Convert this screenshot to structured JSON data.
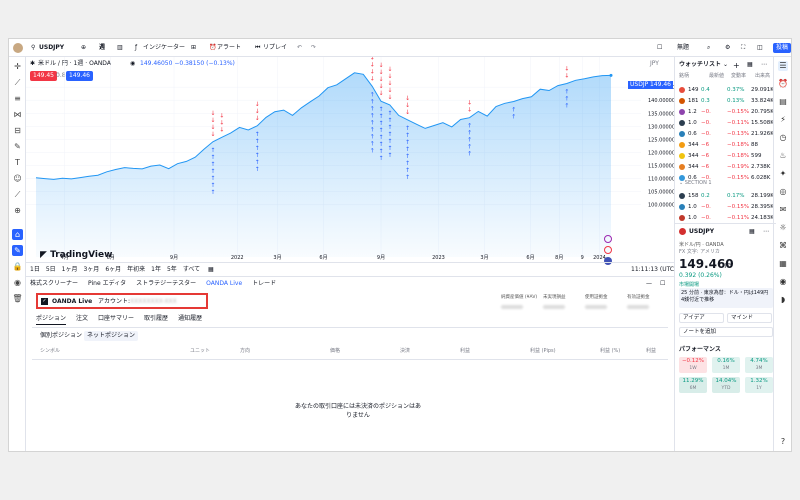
{
  "topbar": {
    "symbol": "USDJPY",
    "indicators": "インジケーター",
    "alert": "アラート",
    "replay": "リプレイ",
    "save_label": "無題",
    "publish": "投稿"
  },
  "legend": {
    "title": "米ドル / 円 · 1週 · OANDA",
    "ohlc": "149.46050  −0.38150 (−0.13%)",
    "sell": "149.45",
    "buy": "149.46",
    "spread": "0.8"
  },
  "yaxis": {
    "currency": "JPY",
    "price_tag": "USDJPY",
    "current": "149.46",
    "ticks": [
      "145.00000",
      "140.00000",
      "135.00000",
      "130.00000",
      "125.00000",
      "120.00000",
      "115.00000",
      "110.00000",
      "105.00000",
      "100.00000"
    ]
  },
  "xaxis": {
    "ticks": [
      "4月",
      "6月",
      "9月",
      "2022",
      "3月",
      "6月",
      "9月",
      "2023",
      "3月",
      "6月",
      "8月",
      "9",
      "2024"
    ]
  },
  "watermark": "TradingView",
  "timeframes": [
    "1日",
    "5日",
    "1ヶ月",
    "3ヶ月",
    "6ヶ月",
    "年初来",
    "1年",
    "5年",
    "すべて"
  ],
  "clock": "11:11:13 (UTC+9)",
  "bottom": {
    "tabs": [
      "株式スクリーナー",
      "Pine エディタ",
      "ストラテジーテスター",
      "OANDA Live",
      "トレード"
    ],
    "broker": "OANDA Live",
    "account_label": "アカウント:",
    "account_value": "XXXXXXXX-XXX",
    "stats": [
      "純資産価値 (¥AV)",
      "未実現損益",
      "使用証拠金",
      "有効証拠金"
    ],
    "subtabs": [
      "ポジション",
      "注文",
      "口座サマリー",
      "取引履歴",
      "通知履歴"
    ],
    "filters": [
      "個別ポジション",
      "ネットポジション"
    ],
    "columns": [
      "シンボル",
      "ユニット",
      "方向",
      "価格",
      "決済",
      "利益",
      "利益 (Pips)",
      "利益 (%)",
      "利益"
    ],
    "empty": "あなたの取引口座には未決済のポジションはありません"
  },
  "watchlist": {
    "title": "ウォッチリスト",
    "cols": [
      "銘柄",
      "最新値",
      "変動率",
      "出来高"
    ],
    "rows": [
      {
        "sym": "149",
        "chg": "0.4",
        "pct": "0.37%",
        "vol": "29.091K",
        "up": true,
        "c": "#e74c3c"
      },
      {
        "sym": "181",
        "chg": "0.3",
        "pct": "0.13%",
        "vol": "33.824K",
        "up": true,
        "c": "#d35400"
      },
      {
        "sym": "1.2",
        "chg": "−0.",
        "pct": "−0.15%",
        "vol": "20.795K",
        "up": false,
        "c": "#8e44ad"
      },
      {
        "sym": "1.0",
        "chg": "−0.",
        "pct": "−0.11%",
        "vol": "15.508K",
        "up": false,
        "c": "#2c3e50"
      },
      {
        "sym": "0.6",
        "chg": "−0.",
        "pct": "−0.13%",
        "vol": "21.926K",
        "up": false,
        "c": "#2980b9"
      },
      {
        "sym": "344",
        "chg": "−6",
        "pct": "−0.18%",
        "vol": "88",
        "up": false,
        "c": "#f39c12"
      },
      {
        "sym": "344",
        "chg": "−6",
        "pct": "−0.18%",
        "vol": "599",
        "up": false,
        "c": "#f1c40f"
      },
      {
        "sym": "344",
        "chg": "−6",
        "pct": "−0.19%",
        "vol": "2.738K",
        "up": false,
        "c": "#e67e22"
      },
      {
        "sym": "0.6",
        "chg": "−0.",
        "pct": "−0.15%",
        "vol": "6.028K",
        "up": false,
        "c": "#3498db"
      }
    ],
    "section": "SECTION 1",
    "rows2": [
      {
        "sym": "158",
        "chg": "0.2",
        "pct": "0.17%",
        "vol": "28.199K",
        "up": true,
        "c": "#2c3e50"
      },
      {
        "sym": "1.0",
        "chg": "−0.",
        "pct": "−0.15%",
        "vol": "28.395K",
        "up": false,
        "c": "#2980b9"
      },
      {
        "sym": "1.0",
        "chg": "−0.",
        "pct": "−0.11%",
        "vol": "24.183K",
        "up": false,
        "c": "#c0392b"
      }
    ]
  },
  "detail": {
    "symbol": "USDJPY",
    "name": "米ドル/円",
    "exchange": "OANDA",
    "region": "FX 文字: アメリカ",
    "price": "149.460",
    "unit": "JPY",
    "change": "0.392 (0.26%)",
    "status": "市場開場",
    "news": "25 分前 · 東京為替：ドル・円は149円4銭付近で推移",
    "idea": "アイデア",
    "mind": "マインド",
    "note": "ノートを追加",
    "perf_title": "パフォーマンス",
    "perf": [
      {
        "v": "−0.12%",
        "l": "1W"
      },
      {
        "v": "0.16%",
        "l": "1M"
      },
      {
        "v": "4.74%",
        "l": "3M"
      },
      {
        "v": "11.29%",
        "l": "6M"
      },
      {
        "v": "14.04%",
        "l": "YTD"
      },
      {
        "v": "1.32%",
        "l": "1Y"
      }
    ]
  },
  "chart_data": {
    "type": "line",
    "series_name": "USDJPY",
    "ylim": [
      100,
      150
    ],
    "values": [
      110.3,
      110.0,
      109.7,
      110.1,
      109.9,
      110.4,
      110.9,
      111.3,
      112.6,
      113.5,
      114.2,
      113.9,
      113.7,
      114.8,
      115.2,
      113.8,
      115.7,
      116.6,
      118.2,
      121.3,
      124.1,
      125.8,
      127.4,
      129.6,
      128.6,
      130.2,
      133.4,
      135.6,
      136.2,
      134.2,
      137.1,
      139.4,
      141.6,
      144.8,
      145.9,
      148.2,
      150.5,
      149.9,
      145.3,
      139.6,
      138.2,
      134.2,
      132.5,
      130.8,
      129.2,
      130.3,
      131.4,
      129.8,
      132.6,
      133.3,
      135.7,
      133.9,
      137.6,
      138.8,
      139.5,
      140.6,
      141.3,
      144.2,
      143.7,
      145.6,
      146.4,
      147.6,
      148.2,
      148.9,
      149.4,
      149.5
    ],
    "x_ticks": [
      "4月",
      "6月",
      "9月",
      "2022",
      "3月",
      "6月",
      "9月",
      "2023",
      "3月",
      "6月",
      "8月",
      "9",
      "2024"
    ]
  }
}
